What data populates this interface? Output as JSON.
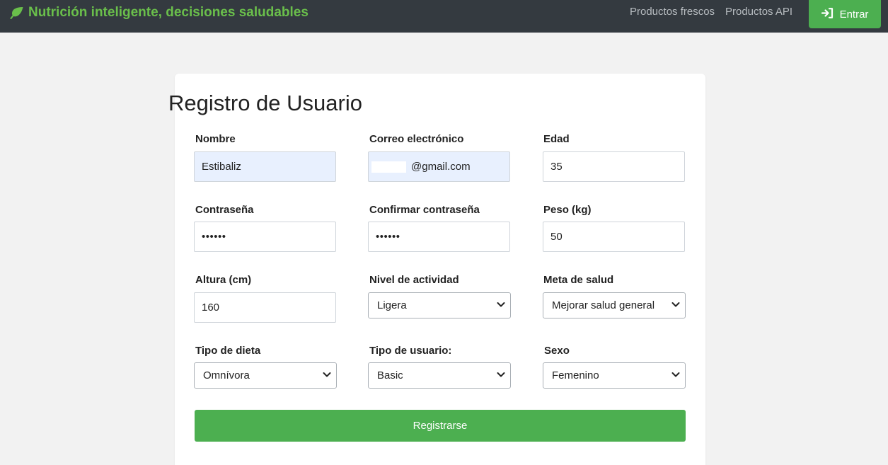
{
  "navbar": {
    "brand_text": "Nutrición inteligente, decisiones saludables",
    "brand_icon": "leaf-icon",
    "links": [
      "Productos frescos",
      "Productos API"
    ],
    "login_label": "Entrar",
    "login_icon": "sign-in-icon",
    "brand_color": "#6abf4b",
    "accent_color": "#4caf50"
  },
  "form": {
    "title": "Registro de Usuario",
    "nombre": {
      "label": "Nombre",
      "value": "Estibaliz"
    },
    "correo": {
      "label": "Correo electrónico",
      "value": "@gmail.com"
    },
    "edad": {
      "label": "Edad",
      "value": "35"
    },
    "contrasena": {
      "label": "Contraseña",
      "value": "••••••"
    },
    "confirmar": {
      "label": "Confirmar contraseña",
      "value": "••••••"
    },
    "peso": {
      "label": "Peso (kg)",
      "value": "50"
    },
    "altura": {
      "label": "Altura (cm)",
      "value": "160"
    },
    "actividad": {
      "label": "Nivel de actividad",
      "value": "Ligera"
    },
    "meta": {
      "label": "Meta de salud",
      "value": "Mejorar salud general"
    },
    "dieta": {
      "label": "Tipo de dieta",
      "value": "Omnívora"
    },
    "usuario": {
      "label": "Tipo de usuario:",
      "value": "Basic"
    },
    "sexo": {
      "label": "Sexo",
      "value": "Femenino"
    },
    "submit_label": "Registrarse"
  }
}
